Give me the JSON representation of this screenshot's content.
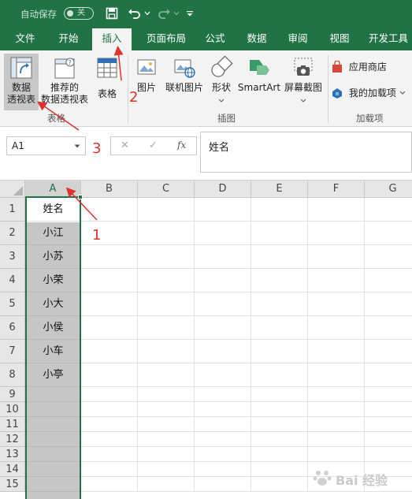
{
  "titlebar": {
    "autosave_label": "自动保存",
    "autosave_state": "关"
  },
  "tabs": [
    {
      "label": "文件"
    },
    {
      "label": "开始"
    },
    {
      "label": "插入"
    },
    {
      "label": "页面布局"
    },
    {
      "label": "公式"
    },
    {
      "label": "数据"
    },
    {
      "label": "审阅"
    },
    {
      "label": "视图"
    },
    {
      "label": "开发工具"
    }
  ],
  "ribbon": {
    "pivot_line1": "数据",
    "pivot_line2": "透视表",
    "recommended_line1": "推荐的",
    "recommended_line2": "数据透视表",
    "table_label": "表格",
    "picture_label": "图片",
    "online_picture_label": "联机图片",
    "shapes_label": "形状",
    "smartart_label": "SmartArt",
    "screenshot_label": "屏幕截图",
    "store_label": "应用商店",
    "my_addins_label": "我的加载项",
    "group_tables": "表格",
    "group_illustrations": "插图",
    "group_addins": "加载项"
  },
  "formula_bar": {
    "name_box": "A1",
    "cancel_symbol": "✕",
    "enter_symbol": "✓",
    "fx_symbol": "fx",
    "content": "姓名"
  },
  "grid": {
    "columns": [
      "A",
      "B",
      "C",
      "D",
      "E",
      "F",
      "G"
    ],
    "rows": [
      "1",
      "2",
      "3",
      "4",
      "5",
      "6",
      "7",
      "8",
      "9",
      "10",
      "11",
      "12",
      "13",
      "14",
      "15"
    ],
    "col_a_values": [
      "姓名",
      "小江",
      "小苏",
      "小荣",
      "小大",
      "小侯",
      "小车",
      "小亭"
    ]
  },
  "annotations": {
    "step1": "1",
    "step2": "2",
    "step3": "3",
    "color": "#e0312b"
  },
  "watermark": "Bai 经验"
}
